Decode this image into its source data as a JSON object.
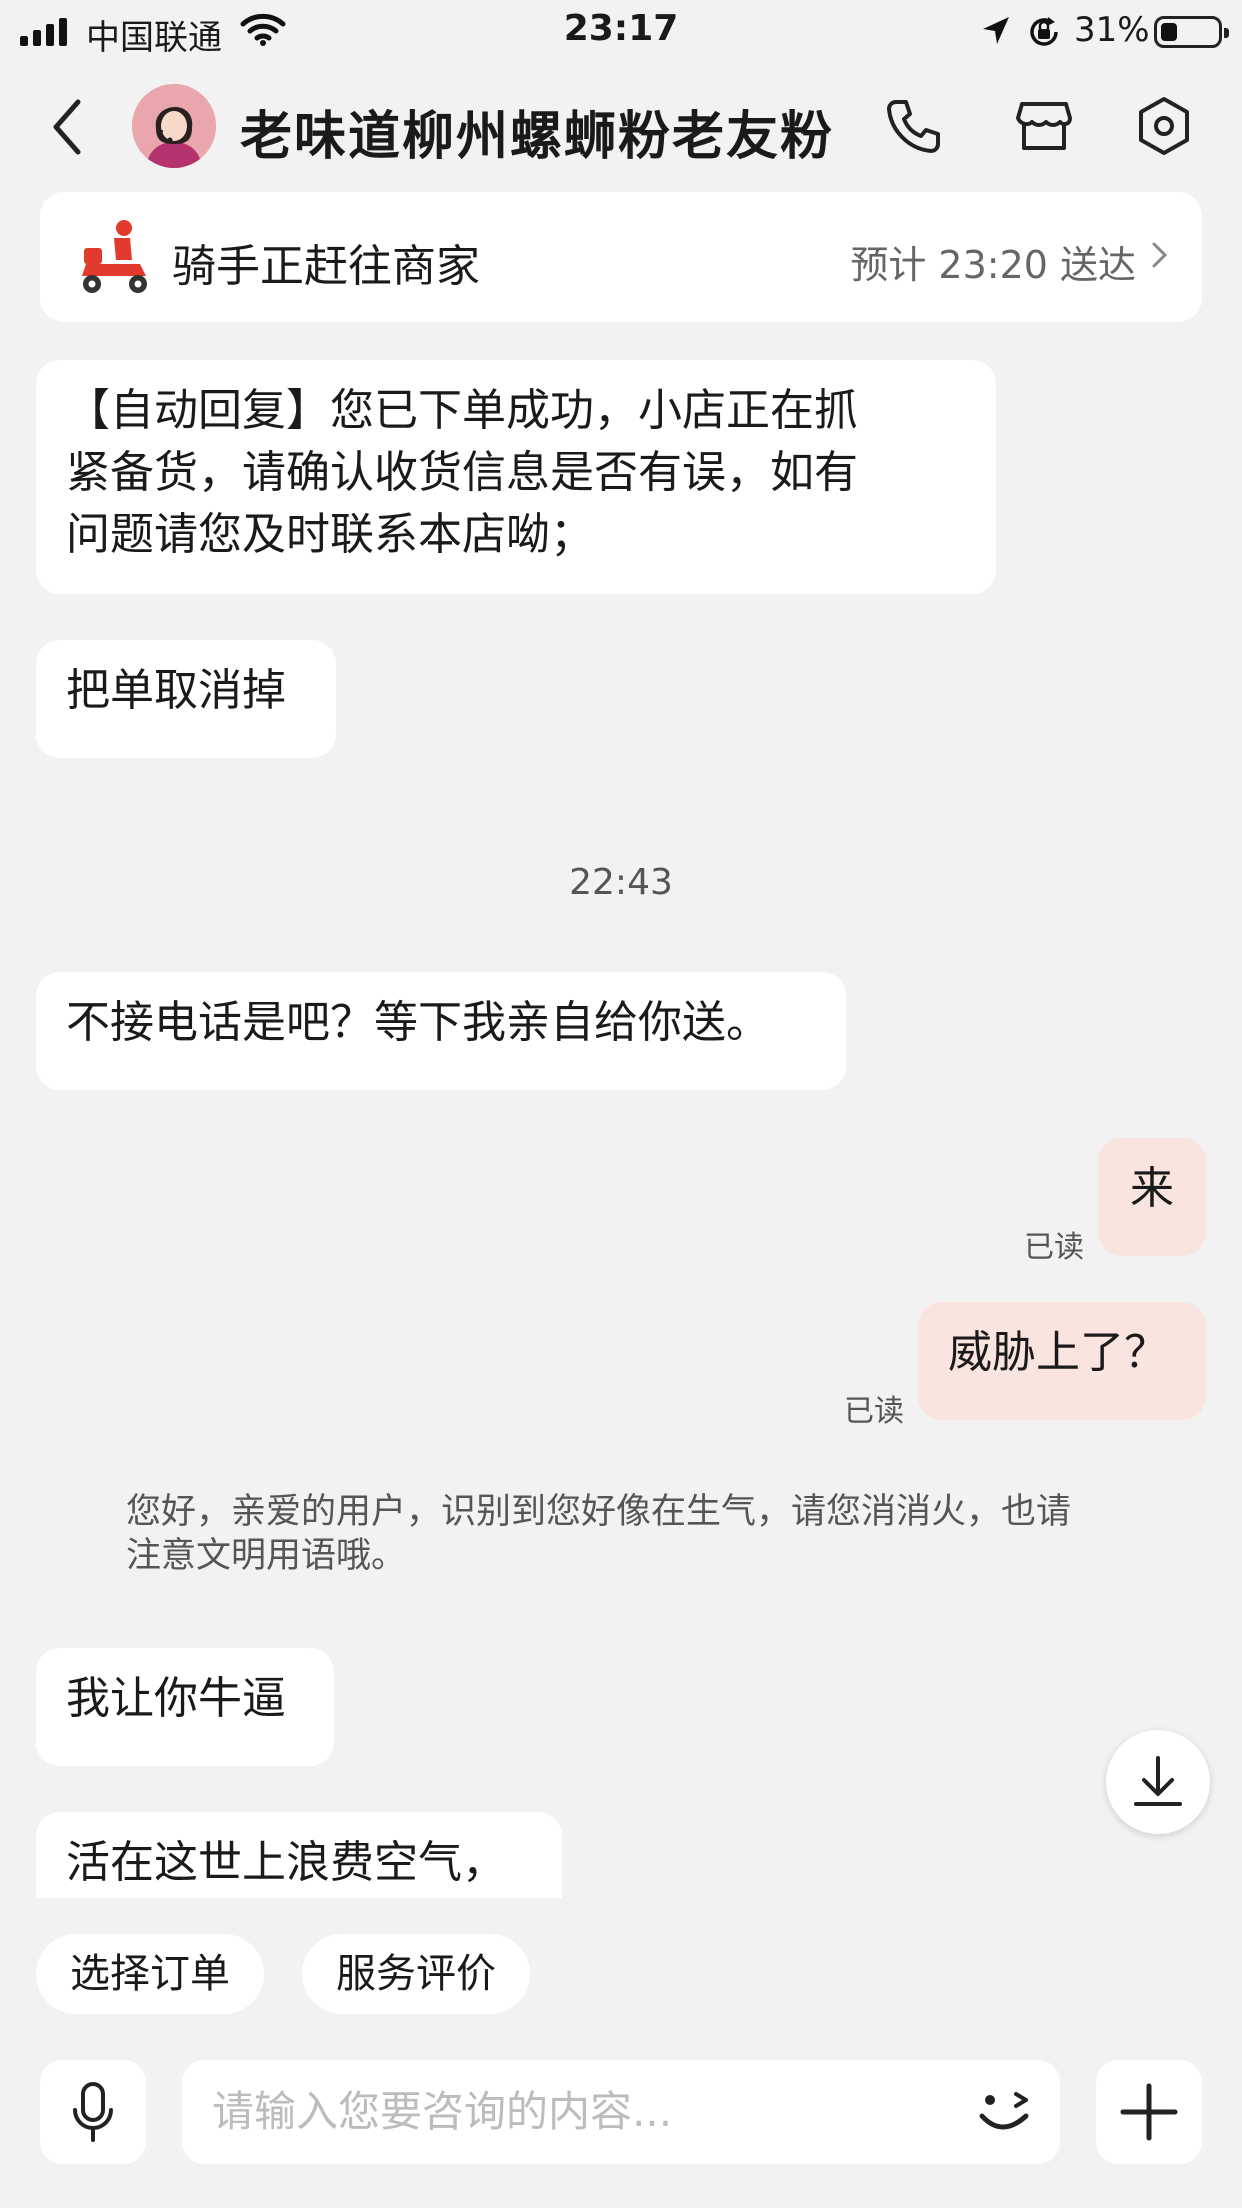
{
  "status_bar": {
    "carrier": "中国联通",
    "time": "23:17",
    "battery": "31%"
  },
  "header": {
    "title": "老味道柳州螺蛳粉老友粉"
  },
  "rider": {
    "status": "骑手正赶往商家",
    "eta": "预计 23:20 送达"
  },
  "messages": {
    "auto_reply": [
      "【自动回复】您已下单成功，小店正在抓",
      "紧备货，请确认收货信息是否有误，如有",
      "问题请您及时联系本店呦；"
    ],
    "m1": "把单取消掉",
    "timestamp": "22:43",
    "m2": "不接电话是吧？等下我亲自给你送。",
    "me1": "来",
    "me1_read": "已读",
    "me2": "威胁上了？",
    "me2_read": "已读",
    "notice": [
      "您好，亲爱的用户，识别到您好像在生气，请您消消火，也请",
      "注意文明用语哦。"
    ],
    "m3": "我让你牛逼",
    "m4": "活在这世上浪费空气，"
  },
  "chips": {
    "select_order": "选择订单",
    "service_review": "服务评价"
  },
  "input": {
    "placeholder": "请输入您要咨询的内容..."
  }
}
